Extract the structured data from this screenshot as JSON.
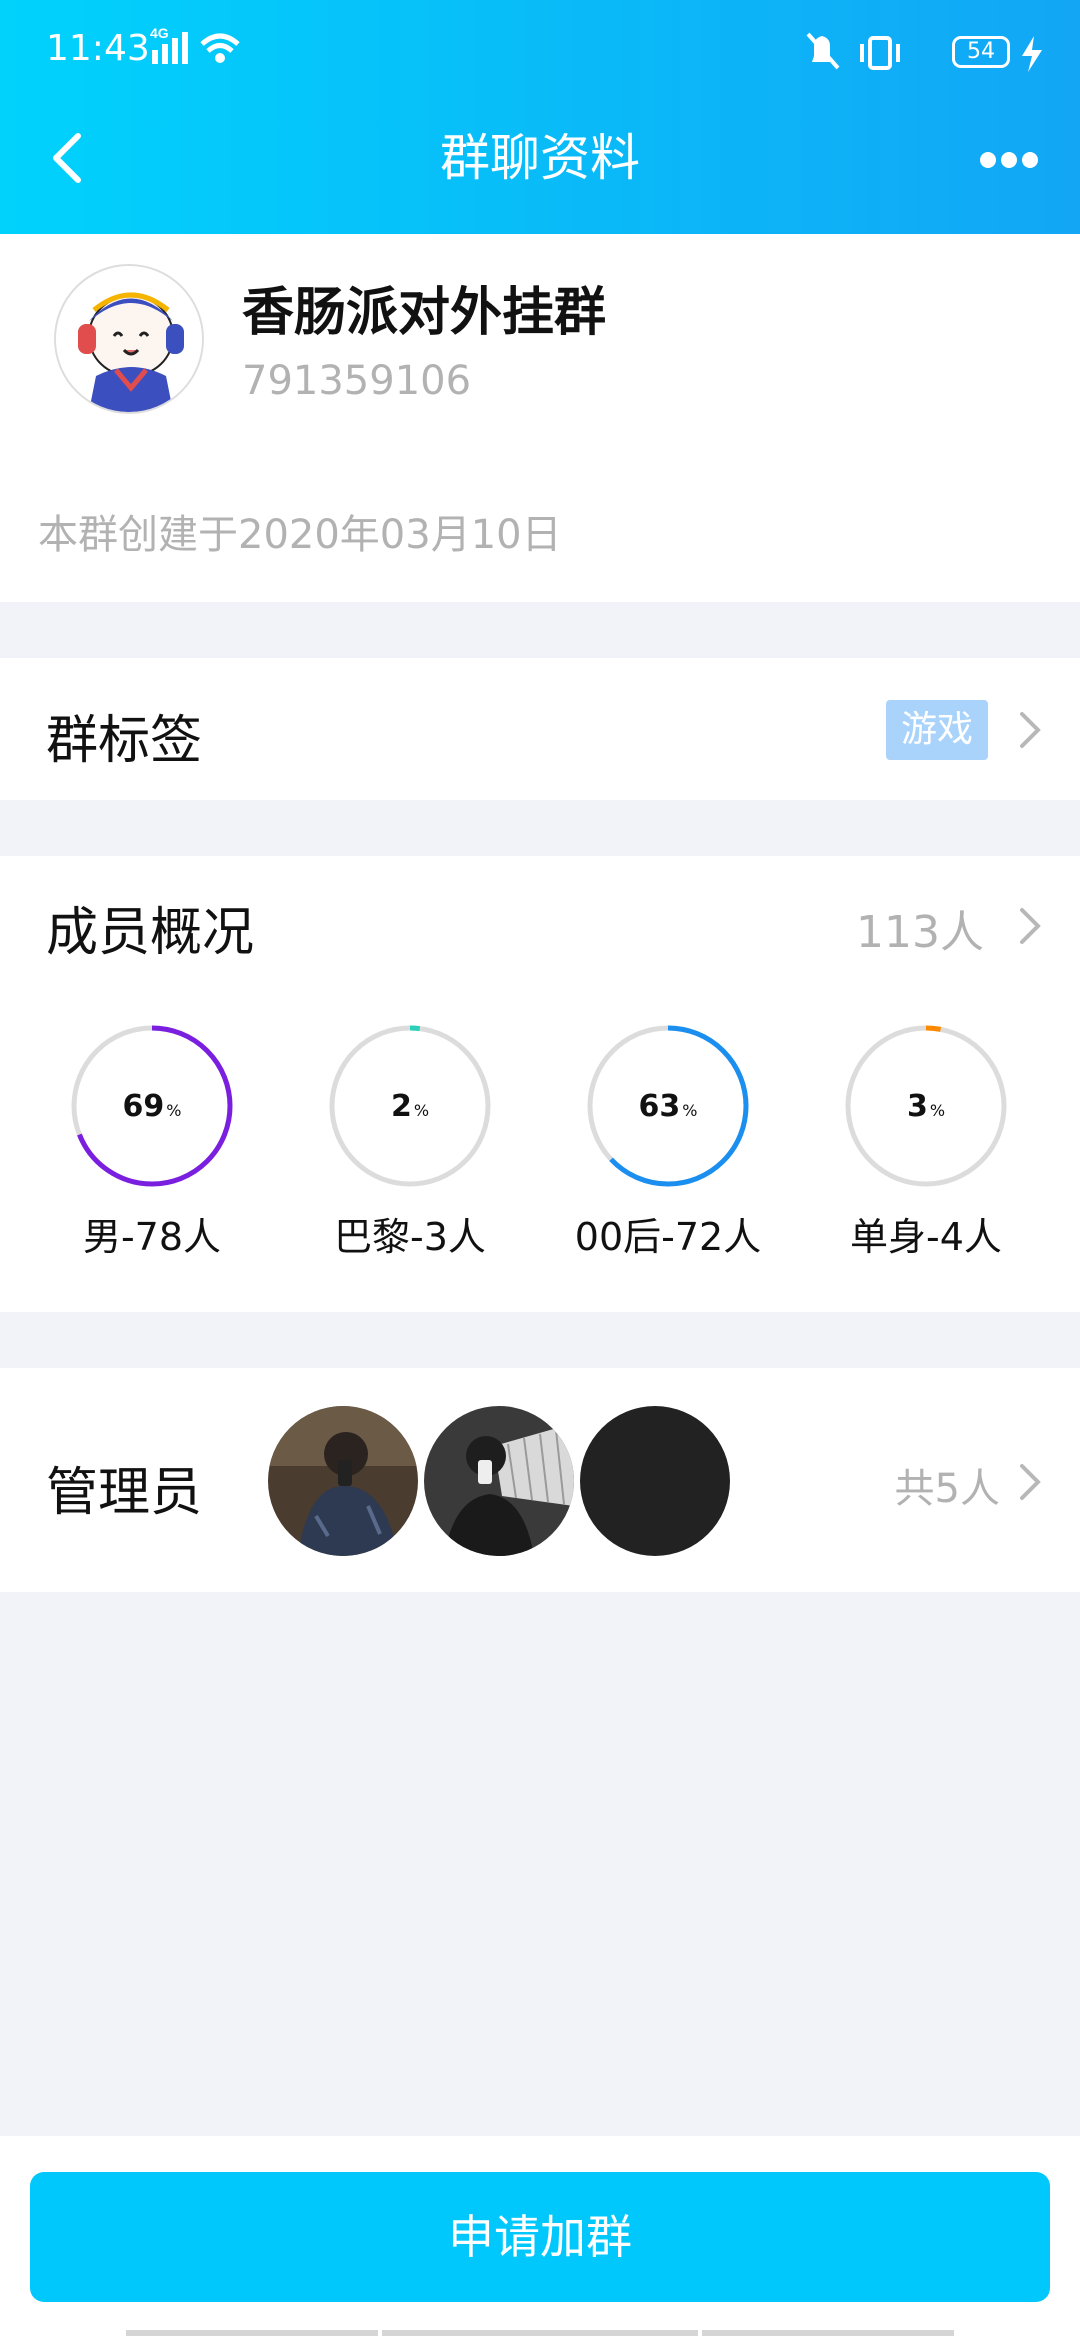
{
  "status_bar": {
    "time": "11:43",
    "network": "4G",
    "battery": "54"
  },
  "header": {
    "title": "群聊资料"
  },
  "group": {
    "name": "香肠派对外挂群",
    "id": "791359106",
    "created": "本群创建于2020年03月10日"
  },
  "tag_row": {
    "label": "群标签",
    "tag": "游戏"
  },
  "members": {
    "label": "成员概况",
    "count": "113人",
    "stats": [
      {
        "value": "69",
        "unit": "%",
        "label": "男-78人",
        "percent": 69,
        "color": "#7a1fe0"
      },
      {
        "value": "2",
        "unit": "%",
        "label": "巴黎-3人",
        "percent": 2,
        "color": "#2ad0b8"
      },
      {
        "value": "63",
        "unit": "%",
        "label": "00后-72人",
        "percent": 63,
        "color": "#1b8ff0"
      },
      {
        "value": "3",
        "unit": "%",
        "label": "单身-4人",
        "percent": 3,
        "color": "#ff8a00"
      }
    ]
  },
  "admins": {
    "label": "管理员",
    "total": "共5人"
  },
  "bottom": {
    "join_label": "申请加群"
  }
}
